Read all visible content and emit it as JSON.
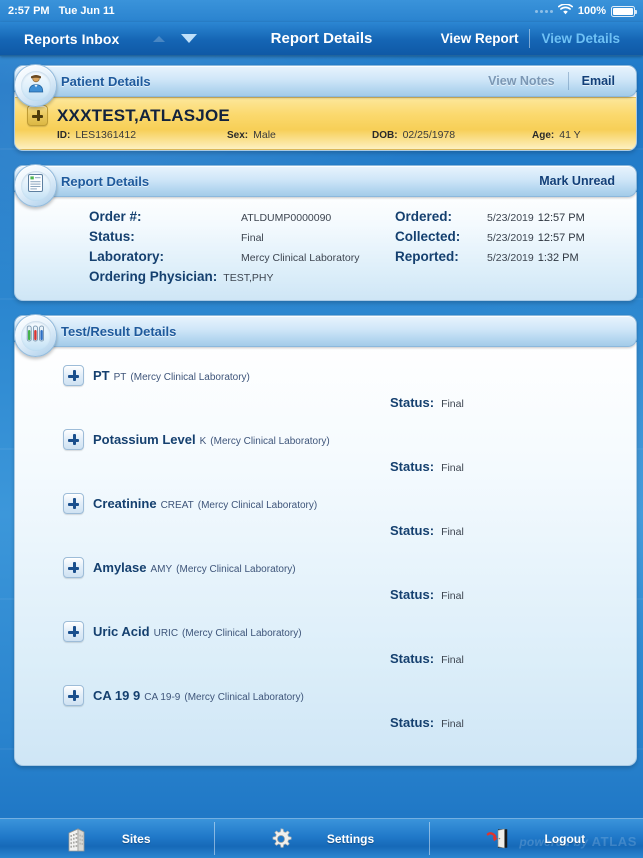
{
  "statusbar": {
    "time": "2:57 PM",
    "date": "Tue Jun 11",
    "battery_percent": "100%",
    "wifi_icon": "wifi-icon",
    "battery_icon": "battery-full-icon",
    "signal_icon": "signal-dots-icon"
  },
  "navbar": {
    "left_title": "Reports Inbox",
    "center_title": "Report Details",
    "up_chevron_icon": "chevron-up-icon",
    "down_chevron_icon": "chevron-down-icon",
    "view_report_label": "View Report",
    "view_details_label": "View Details"
  },
  "patient_panel": {
    "header_title": "Patient Details",
    "header_icon": "person-icon",
    "view_notes_label": "View Notes",
    "email_label": "Email",
    "expand_icon": "plus-icon",
    "name": "XXXTEST,ATLASJOE",
    "fields": [
      {
        "label": "ID:",
        "value": "LES1361412"
      },
      {
        "label": "Sex:",
        "value": "Male"
      },
      {
        "label": "DOB:",
        "value": "02/25/1978"
      },
      {
        "label": "Age:",
        "value": "41 Y"
      }
    ]
  },
  "report_panel": {
    "header_title": "Report Details",
    "header_icon": "document-icon",
    "mark_unread_label": "Mark Unread",
    "left_fields": [
      {
        "label": "Order #:",
        "value": "ATLDUMP0000090"
      },
      {
        "label": "Status:",
        "value": "Final"
      },
      {
        "label": "Laboratory:",
        "value": "Mercy Clinical Laboratory"
      },
      {
        "label": "Ordering Physician:",
        "value": "TEST,PHY"
      }
    ],
    "right_fields": [
      {
        "label": "Ordered:",
        "date": "5/23/2019",
        "time": "12:57 PM"
      },
      {
        "label": "Collected:",
        "date": "5/23/2019",
        "time": "12:57 PM"
      },
      {
        "label": "Reported:",
        "date": "5/23/2019",
        "time": "1:32 PM"
      }
    ]
  },
  "test_panel": {
    "header_title": "Test/Result Details",
    "header_icon": "test-tubes-icon",
    "status_label": "Status:",
    "expand_icon": "plus-icon",
    "tests": [
      {
        "name": "PT",
        "code": "PT",
        "lab": "(Mercy Clinical Laboratory)",
        "status": "Final"
      },
      {
        "name": "Potassium Level",
        "code": "K",
        "lab": "(Mercy Clinical Laboratory)",
        "status": "Final"
      },
      {
        "name": "Creatinine",
        "code": "CREAT",
        "lab": "(Mercy Clinical Laboratory)",
        "status": "Final"
      },
      {
        "name": "Amylase",
        "code": "AMY",
        "lab": "(Mercy Clinical Laboratory)",
        "status": "Final"
      },
      {
        "name": "Uric Acid",
        "code": "URIC",
        "lab": "(Mercy Clinical Laboratory)",
        "status": "Final"
      },
      {
        "name": "CA 19  9",
        "code": "CA 19-9",
        "lab": "(Mercy Clinical Laboratory)",
        "status": "Final"
      }
    ]
  },
  "toolbar": {
    "sites_label": "Sites",
    "sites_icon": "building-icon",
    "settings_label": "Settings",
    "settings_icon": "gear-icon",
    "logout_label": "Logout",
    "logout_icon": "logout-door-icon",
    "watermark_prefix": "powered by ",
    "watermark_brand": "ATLAS"
  },
  "colors": {
    "nav_blue": "#1565b4",
    "accent_cyan": "#6ec1f5",
    "panel_blue": "#15406f",
    "gold_row": "#fbd96e"
  }
}
